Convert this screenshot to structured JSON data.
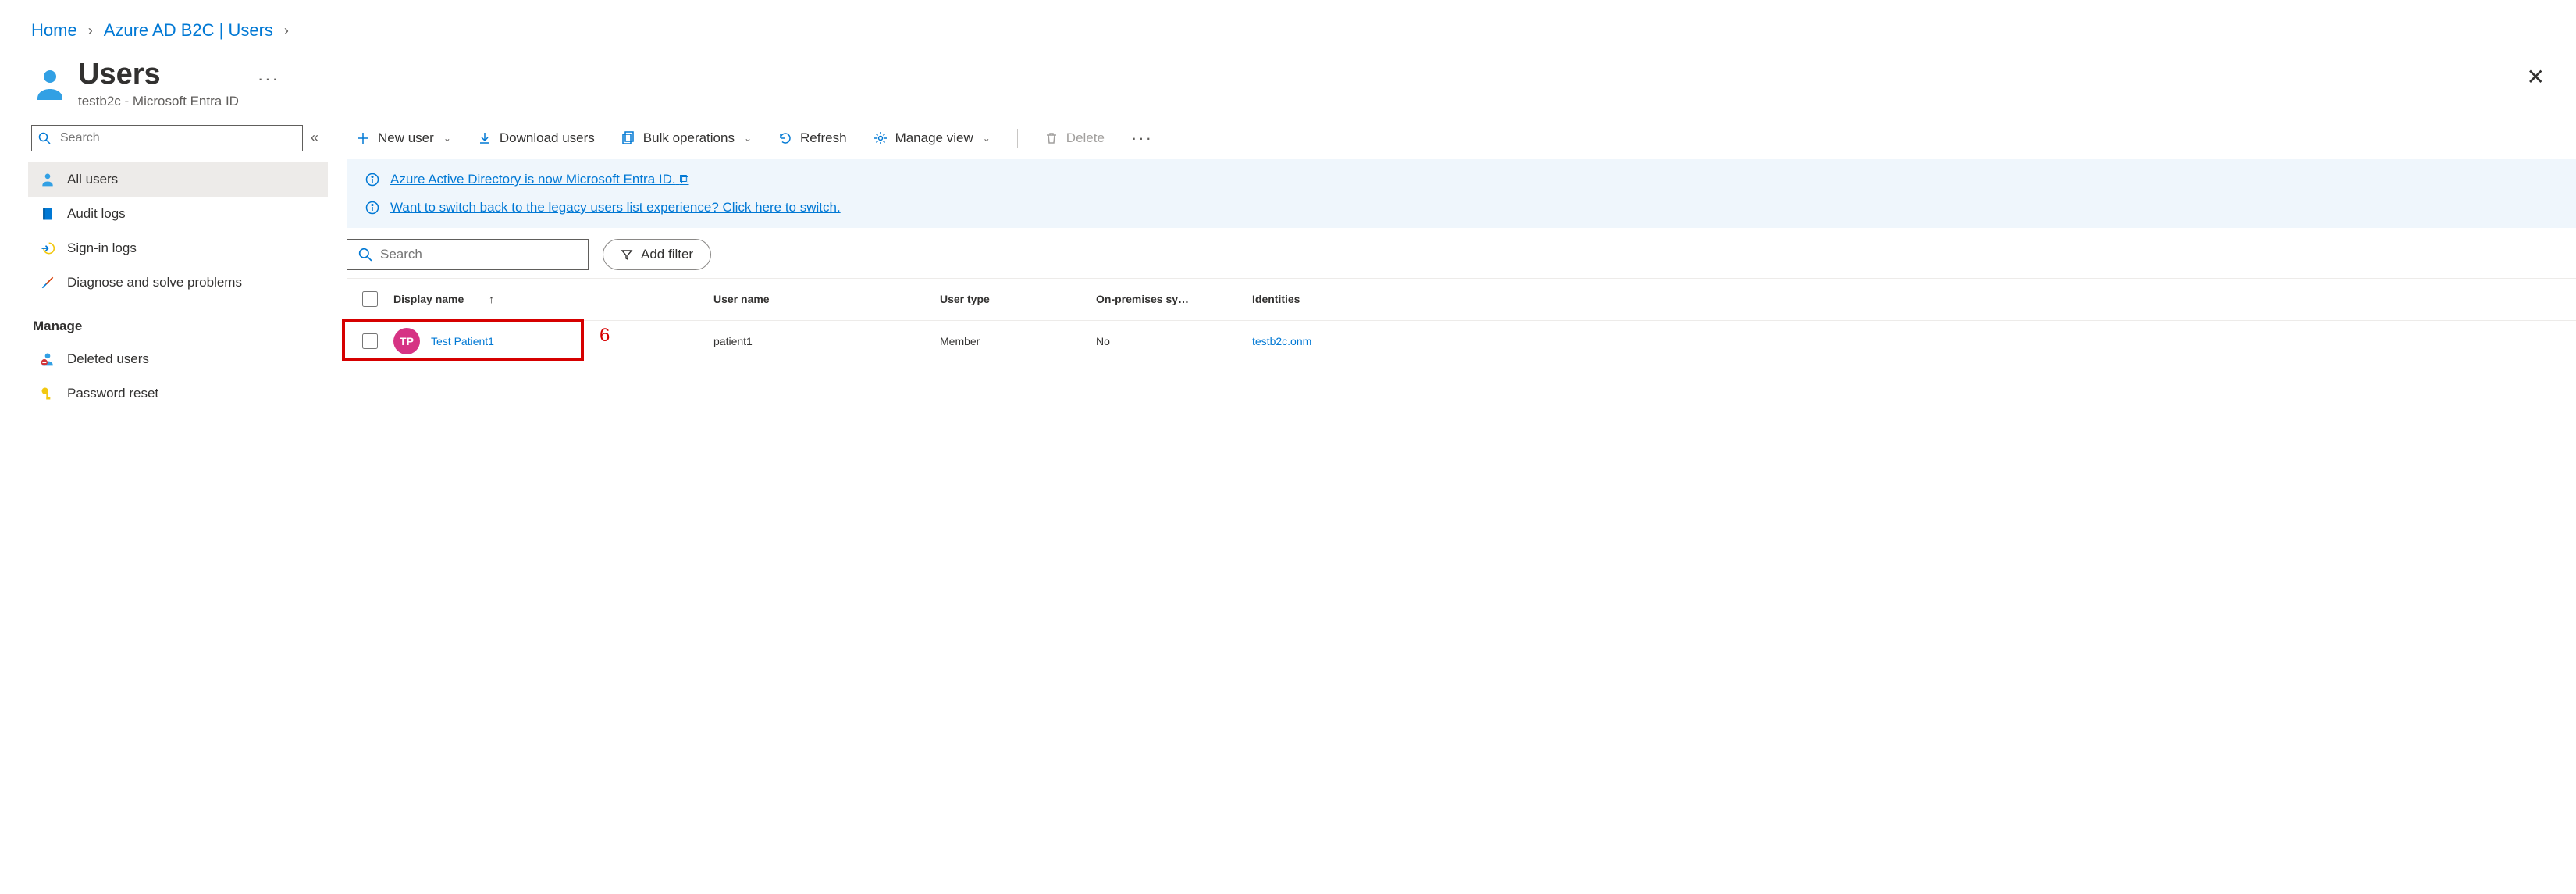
{
  "breadcrumb": {
    "home": "Home",
    "mid": "Azure AD B2C | Users"
  },
  "header": {
    "title": "Users",
    "tenant": "testb2c - Microsoft Entra ID"
  },
  "sidebar": {
    "search_placeholder": "Search",
    "items": {
      "all_users": "All users",
      "audit_logs": "Audit logs",
      "signin_logs": "Sign-in logs",
      "diagnose": "Diagnose and solve problems"
    },
    "manage_label": "Manage",
    "manage_items": {
      "deleted_users": "Deleted users",
      "password_reset": "Password reset"
    }
  },
  "toolbar": {
    "new_user": "New user",
    "download": "Download users",
    "bulk": "Bulk operations",
    "refresh": "Refresh",
    "manage_view": "Manage view",
    "delete": "Delete"
  },
  "info": {
    "entra": "Azure Active Directory is now Microsoft Entra ID.",
    "legacy": "Want to switch back to the legacy users list experience? Click here to switch."
  },
  "filter": {
    "search_placeholder": "Search",
    "add_filter": "Add filter"
  },
  "table": {
    "cols": {
      "display_name": "Display name",
      "user_name": "User name",
      "user_type": "User type",
      "onprem": "On-premises sy…",
      "identities": "Identities"
    },
    "rows": [
      {
        "initials": "TP",
        "display_name": "Test Patient1",
        "user_name": "patient1",
        "user_type": "Member",
        "onprem": "No",
        "identities": "testb2c.onm"
      }
    ]
  },
  "annotation": {
    "number": "6"
  }
}
